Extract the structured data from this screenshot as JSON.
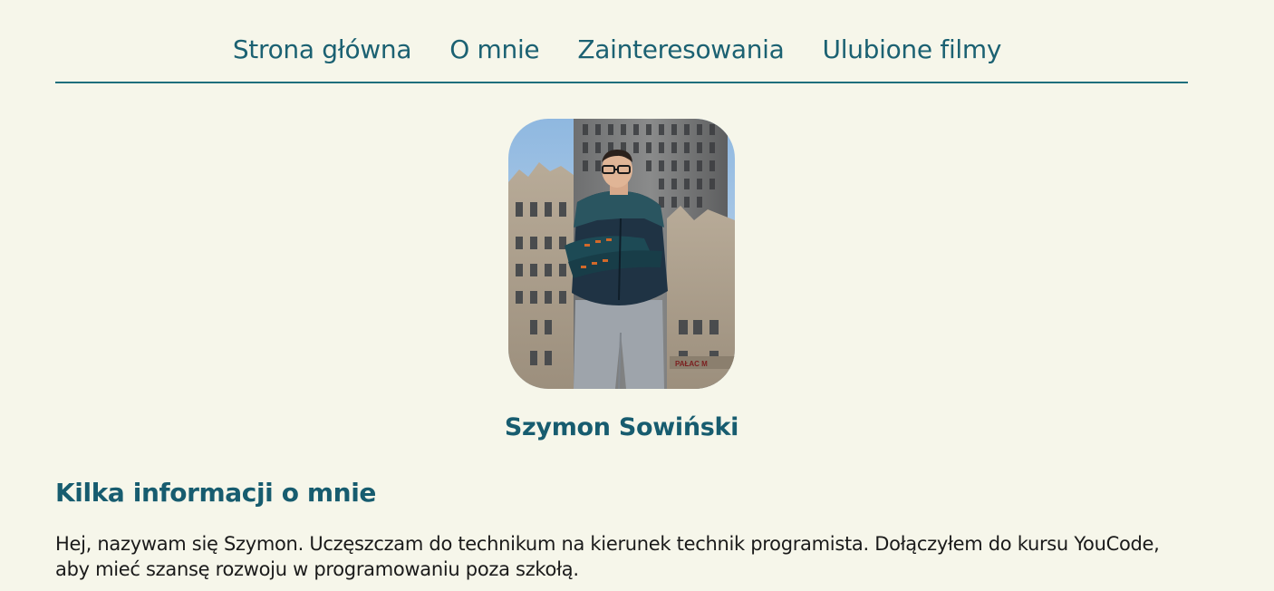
{
  "nav": {
    "items": [
      {
        "label": "Strona główna"
      },
      {
        "label": "O mnie"
      },
      {
        "label": "Zainteresowania"
      },
      {
        "label": "Ulubione filmy"
      }
    ]
  },
  "profile": {
    "name": "Szymon Sowiński",
    "photo_sign": "PAŁAC M"
  },
  "about": {
    "heading": "Kilka informacji o mnie",
    "body": "Hej, nazywam się Szymon. Uczęszczam do technikum na kierunek technik programista. Dołączyłem do kursu YouCode, aby mieć szansę rozwoju w programowaniu poza szkołą."
  },
  "colors": {
    "background": "#f6f6ea",
    "accent": "#1f6f7d",
    "heading": "#175c6f",
    "text": "#1a1a1a"
  }
}
